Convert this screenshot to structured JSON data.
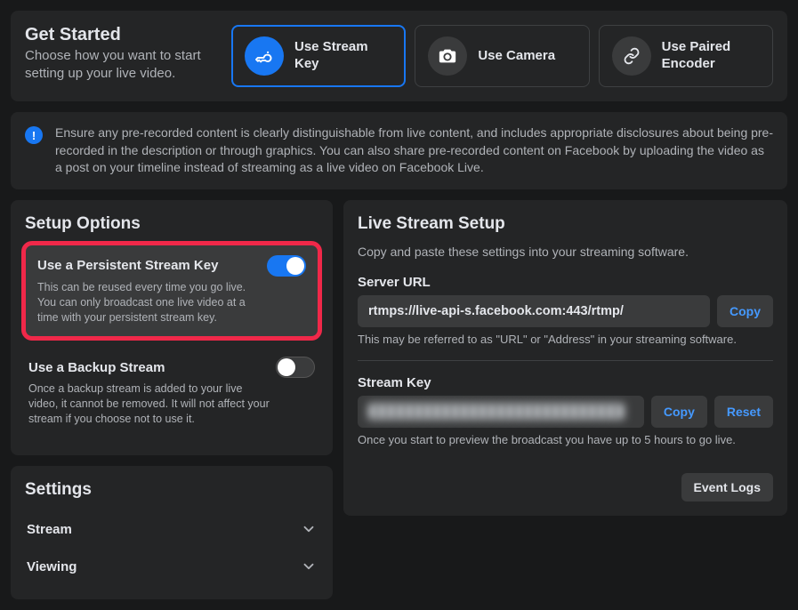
{
  "getStarted": {
    "title": "Get Started",
    "subtitle": "Choose how you want to start setting up your live video.",
    "methods": [
      {
        "label": "Use Stream Key",
        "icon": "key-icon",
        "selected": true
      },
      {
        "label": "Use Camera",
        "icon": "camera-icon",
        "selected": false
      },
      {
        "label": "Use Paired Encoder",
        "icon": "link-icon",
        "selected": false
      }
    ]
  },
  "alert": {
    "text": "Ensure any pre-recorded content is clearly distinguishable from live content, and includes appropriate disclosures about being pre-recorded in the description or through graphics. You can also share pre-recorded content on Facebook by uploading the video as a post on your timeline instead of streaming as a live video on Facebook Live."
  },
  "setupOptions": {
    "title": "Setup Options",
    "persistent": {
      "title": "Use a Persistent Stream Key",
      "desc": "This can be reused every time you go live. You can only broadcast one live video at a time with your persistent stream key.",
      "enabled": true
    },
    "backup": {
      "title": "Use a Backup Stream",
      "desc": "Once a backup stream is added to your live video, it cannot be removed. It will not affect your stream if you choose not to use it.",
      "enabled": false
    }
  },
  "settings": {
    "title": "Settings",
    "rows": [
      "Stream",
      "Viewing"
    ]
  },
  "liveStream": {
    "title": "Live Stream Setup",
    "subtitle": "Copy and paste these settings into your streaming software.",
    "serverUrl": {
      "label": "Server URL",
      "value": "rtmps://live-api-s.facebook.com:443/rtmp/",
      "help": "This may be referred to as \"URL\" or \"Address\" in your streaming software.",
      "copy": "Copy"
    },
    "streamKey": {
      "label": "Stream Key",
      "help": "Once you start to preview the broadcast you have up to 5 hours to go live.",
      "copy": "Copy",
      "reset": "Reset"
    },
    "eventLogs": "Event Logs"
  }
}
